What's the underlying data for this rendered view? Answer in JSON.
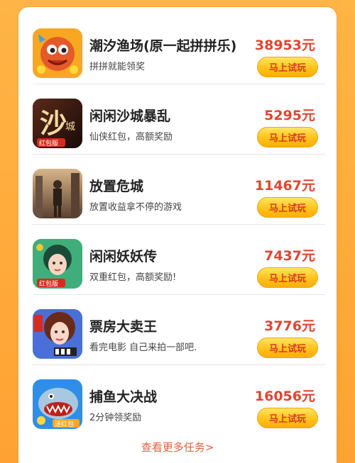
{
  "games": [
    {
      "title": "潮汐渔场(原一起拼拼乐)",
      "desc": "拼拼就能领奖",
      "reward": "38953元",
      "button": "马上试玩",
      "icon": "fish-farm-icon"
    },
    {
      "title": "闲闲沙城暴乱",
      "desc": "仙侠红包，高额奖励",
      "reward": "5295元",
      "button": "马上试玩",
      "icon": "sand-city-icon"
    },
    {
      "title": "放置危城",
      "desc": "放置收益拿不停的游戏",
      "reward": "11467元",
      "button": "马上试玩",
      "icon": "danger-city-icon"
    },
    {
      "title": "闲闲妖妖传",
      "desc": "双重红包，高额奖励!",
      "reward": "7437元",
      "button": "马上试玩",
      "icon": "fairy-legend-icon"
    },
    {
      "title": "票房大卖王",
      "desc": "看完电影 自己来拍一部吧.",
      "reward": "3776元",
      "button": "马上试玩",
      "icon": "box-office-icon"
    },
    {
      "title": "捕鱼大决战",
      "desc": "2分钟领奖励",
      "reward": "16056元",
      "button": "马上试玩",
      "icon": "fishing-battle-icon"
    }
  ],
  "more_link": "查看更多任务>",
  "colors": {
    "reward": "#e2452f",
    "button_text": "#d43b22",
    "button_bg": "#ffc21a",
    "page_bg": "#ffa233"
  }
}
